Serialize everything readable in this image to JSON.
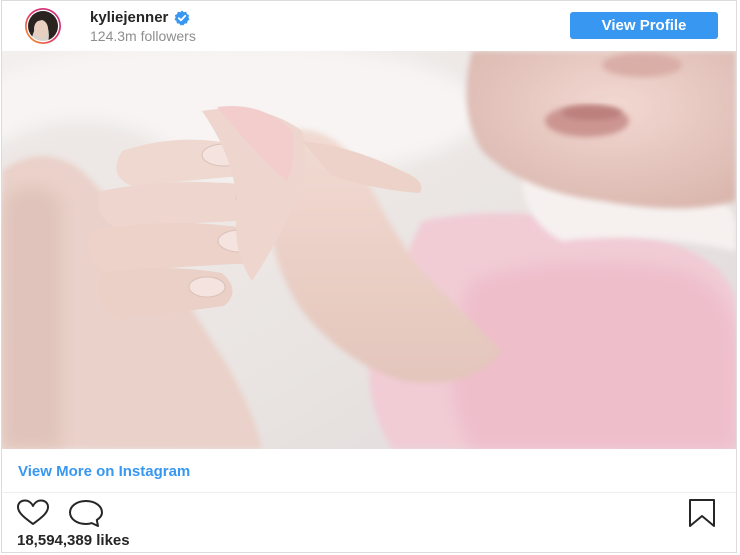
{
  "header": {
    "username": "kyliejenner",
    "followers": "124.3m followers",
    "view_profile_label": "View Profile",
    "verified_icon": "verified-badge-icon",
    "avatar_icon": "profile-avatar"
  },
  "post": {
    "image_icon": "post-photo",
    "view_more_label": "View More on Instagram",
    "likes": "18,594,389 likes"
  },
  "actions": {
    "like_icon": "heart-icon",
    "comment_icon": "comment-icon",
    "save_icon": "bookmark-icon"
  },
  "colors": {
    "accent": "#3897f0",
    "text": "#262626",
    "muted": "#8e8e8e",
    "border": "#dbdbdb"
  }
}
